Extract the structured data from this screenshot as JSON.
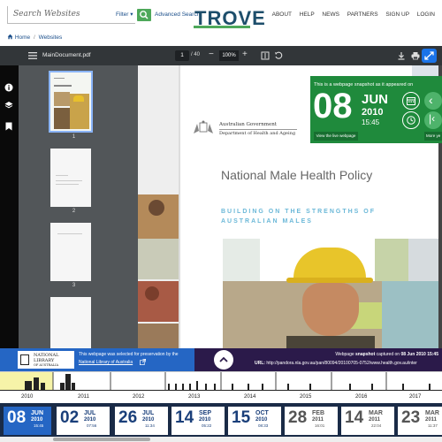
{
  "header": {
    "search_placeholder": "Search Websites",
    "filter_label": "Filter ▾",
    "advanced_search": "Advanced Search",
    "logo": "TROVE",
    "nav": [
      "ABOUT",
      "HELP",
      "NEWS",
      "PARTNERS",
      "SIGN UP",
      "LOGIN"
    ]
  },
  "breadcrumb": {
    "home": "Home",
    "separator": "/",
    "current": "Websites"
  },
  "pdf": {
    "filename": "MainDocument.pdf",
    "page_current": "1",
    "page_total": "/ 40",
    "zoom": "100%",
    "thumb_numbers": [
      "1",
      "2",
      "3"
    ]
  },
  "document": {
    "gov_line1": "Australian Government",
    "gov_line2": "Department of Health and Ageing",
    "title": "National Male Health Policy",
    "subtitle_line1": "BUILDING ON THE STRENGTHS OF",
    "subtitle_line2": "AUSTRALIAN MALES"
  },
  "snapshot": {
    "intro": "This is a webpage snapshot as it appeared on",
    "day": "08",
    "month": "JUN",
    "year": "2010",
    "time": "15:45",
    "view_live": "View the live webpage",
    "more": "More ye"
  },
  "nla": {
    "logo_line1": "NATIONAL",
    "logo_line2": "LIBRARY",
    "logo_line3": "OF AUSTRALIA",
    "text": "This webpage was selected for preservation by the",
    "link": "National Library of Australia"
  },
  "snapinfo": {
    "prefix": "Webpage",
    "snapshot_word": "snapshot",
    "captured": "captured on",
    "captured_date": "08 Jun 2010 15:45",
    "url_label": "URL:",
    "url": "http://pandora.nla.gov.au/pan/80094/20100705-0752/www.health.gov.au/inter"
  },
  "timeline_years": [
    "2010",
    "2011",
    "2012",
    "2013",
    "2014",
    "2015",
    "2016",
    "2017"
  ],
  "dates": [
    {
      "day": "08",
      "mon": "JUN",
      "yr": "2010",
      "tm": "15:45",
      "active": true
    },
    {
      "day": "02",
      "mon": "JUL",
      "yr": "2010",
      "tm": "07:56",
      "active": false
    },
    {
      "day": "26",
      "mon": "JUL",
      "yr": "2010",
      "tm": "11:34",
      "active": false
    },
    {
      "day": "14",
      "mon": "SEP",
      "yr": "2010",
      "tm": "05:22",
      "active": false
    },
    {
      "day": "15",
      "mon": "OCT",
      "yr": "2010",
      "tm": "08:33",
      "active": false
    },
    {
      "day": "28",
      "mon": "FEB",
      "yr": "2011",
      "tm": "16:01",
      "active": false,
      "dim": true
    },
    {
      "day": "14",
      "mon": "MAR",
      "yr": "2011",
      "tm": "22:04",
      "active": false,
      "dim": true
    },
    {
      "day": "23",
      "mon": "MAR",
      "yr": "2011",
      "tm": "11:37",
      "active": false,
      "dim": true
    }
  ],
  "colors": {
    "trove_navy": "#1d4e6b",
    "trove_green": "#4ea85a",
    "snapshot_green": "#1f8a3c",
    "nla_blue": "#2566c4",
    "purple_bar": "#2b1a4a",
    "dates_navy": "#1a2b47",
    "active_date": "#2566c4"
  }
}
